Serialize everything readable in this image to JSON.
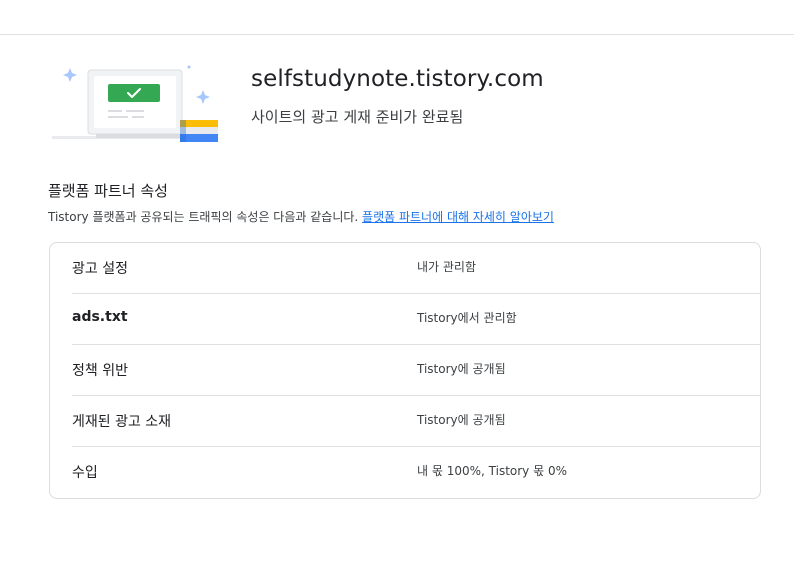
{
  "site": {
    "url": "selfstudynote.tistory.com",
    "status": "사이트의 광고 게재 준비가 완료됨"
  },
  "section": {
    "title": "플랫폼 파트너 속성",
    "description": "Tistory 플랫폼과 공유되는 트래픽의 속성은 다음과 같습니다.",
    "link_text": "플랫폼 파트너에 대해 자세히 알아보기"
  },
  "properties": [
    {
      "label": "광고 설정",
      "value": "내가 관리함"
    },
    {
      "label": "ads.txt",
      "value": "Tistory에서 관리함"
    },
    {
      "label": "정책 위반",
      "value": "Tistory에 공개됨"
    },
    {
      "label": "게재된 광고 소재",
      "value": "Tistory에 공개됨"
    },
    {
      "label": "수입",
      "value": "내 몫 100%, Tistory 몫 0%"
    }
  ],
  "colors": {
    "accent_green": "#34a853",
    "link_blue": "#1a73e8",
    "sparkle_blue": "#a8c7fa",
    "book_yellow": "#fbbc04",
    "book_blue": "#4285f4"
  }
}
